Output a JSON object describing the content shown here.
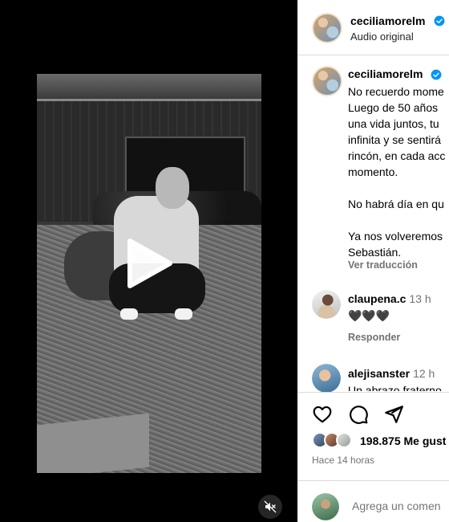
{
  "header": {
    "username": "ceciliamorelm",
    "audio_label": "Audio original"
  },
  "caption": {
    "username": "ceciliamorelm",
    "lines": [
      "No recuerdo mome",
      "Luego de 50 años",
      "una vida juntos, tu",
      "infinita y se sentirá",
      "rincón, en cada acc",
      "momento.",
      "",
      "No habrá día en qu",
      "",
      "Ya nos volveremos",
      "Sebastián."
    ],
    "translate_label": "Ver traducción"
  },
  "comments": [
    {
      "username": "claupena.c",
      "time": "13 h",
      "text": "🖤🖤🖤",
      "reply_label": "Responder"
    },
    {
      "username": "alejisanster",
      "time": "12 h",
      "text": "Un abrazo fraterno"
    }
  ],
  "actions": {
    "like_icon": "heart-icon",
    "comment_icon": "comment-icon",
    "share_icon": "send-icon"
  },
  "likes": {
    "count_text": "198.875 Me gust"
  },
  "time_ago": "Hace 14 horas",
  "add_comment": {
    "placeholder": "Agrega un comen"
  },
  "colors": {
    "verified": "#0095f6",
    "muted_text": "#737373",
    "divider": "#dbdbdb"
  }
}
